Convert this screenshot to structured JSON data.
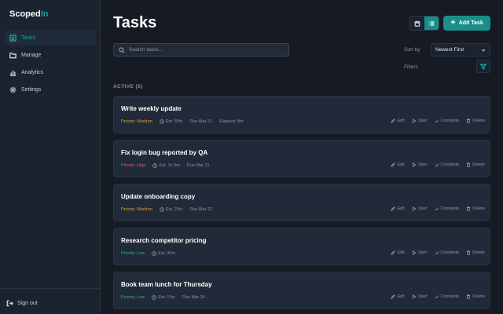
{
  "app": {
    "brand_main": "Scoped",
    "brand_accent": "In",
    "accent_color": "#1aa39a"
  },
  "sidebar": {
    "items": [
      {
        "label": "Tasks",
        "icon": "tasks-icon",
        "active": true
      },
      {
        "label": "Manage",
        "icon": "folder-icon",
        "active": false
      },
      {
        "label": "Analytics",
        "icon": "bar-chart-icon",
        "active": false
      },
      {
        "label": "Settings",
        "icon": "gear-icon",
        "active": false
      }
    ],
    "signout_label": "Sign out"
  },
  "header": {
    "title": "Tasks",
    "add_task_label": "Add Task",
    "view_toggle_active": "list"
  },
  "toolbar": {
    "search_placeholder": "Search tasks...",
    "sort_label": "Sort by",
    "sort_value": "Newest First",
    "filters_label": "Filters"
  },
  "section": {
    "label": "ACTIVE (5)"
  },
  "actions": {
    "edit": "Edit",
    "start": "Start",
    "complete": "Complete",
    "delete": "Delete"
  },
  "tasks": [
    {
      "title": "Write weekly update",
      "priority": "Priority: Medium",
      "priority_level": "medium",
      "estimate": "Est: 30m",
      "due": "Due Mar 21",
      "elapsed": "Elapsed: 8m"
    },
    {
      "title": "Fix login bug reported by QA",
      "priority": "Priority: High",
      "priority_level": "high",
      "estimate": "Est: 1h 0m",
      "due": "Due Mar 21",
      "elapsed": ""
    },
    {
      "title": "Update onboarding copy",
      "priority": "Priority: Medium",
      "priority_level": "medium",
      "estimate": "Est: 20m",
      "due": "Due Mar 22",
      "elapsed": ""
    },
    {
      "title": "Research competitor pricing",
      "priority": "Priority: Low",
      "priority_level": "low",
      "estimate": "Est: 30m",
      "due": "",
      "elapsed": ""
    },
    {
      "title": "Book team lunch for Thursday",
      "priority": "Priority: Low",
      "priority_level": "low",
      "estimate": "Est: 15m",
      "due": "Due Mar 24",
      "elapsed": ""
    }
  ]
}
